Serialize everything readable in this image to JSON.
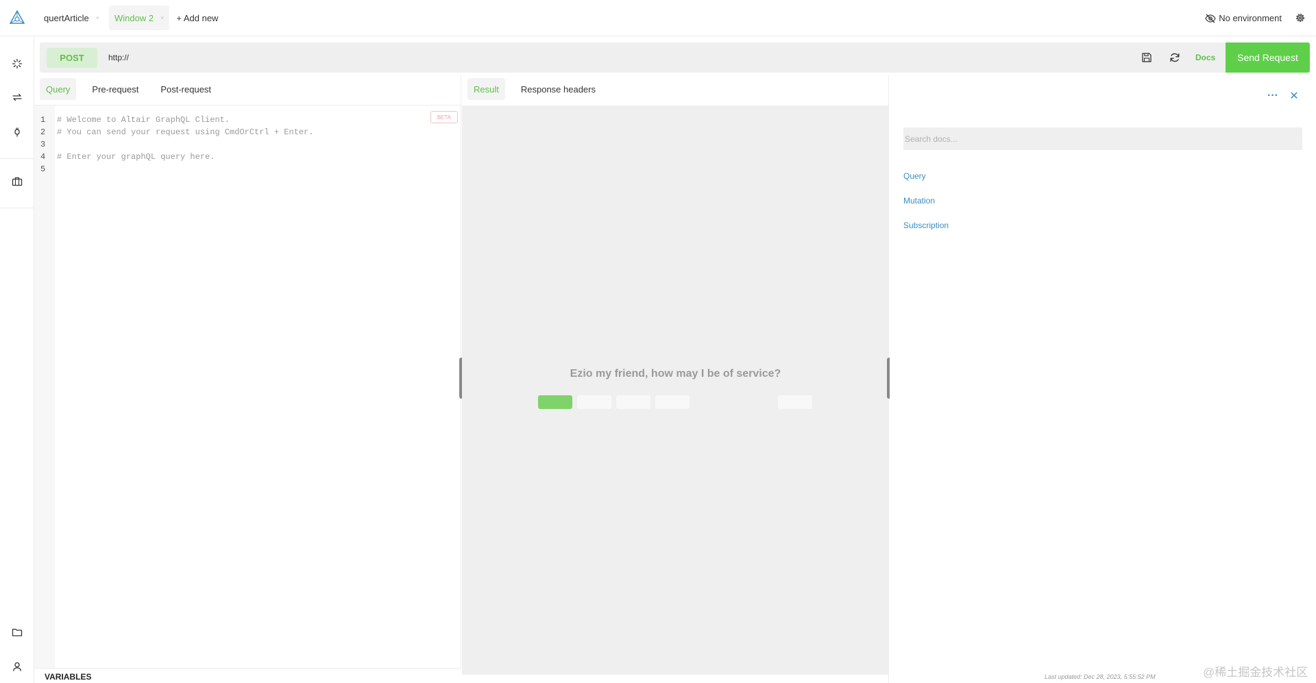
{
  "tabs": [
    {
      "label": "quertArticle",
      "close": "×"
    },
    {
      "label": "Window 2",
      "close": "×"
    }
  ],
  "add_new": "+ Add new",
  "environment": "No environment",
  "request": {
    "method": "POST",
    "url": "http://",
    "docs_label": "Docs",
    "send_label": "Send Request"
  },
  "query_tabs": [
    "Query",
    "Pre-request",
    "Post-request"
  ],
  "editor": {
    "line_numbers": [
      "1",
      "2",
      "3",
      "4",
      "5"
    ],
    "lines": [
      "# Welcome to Altair GraphQL Client.",
      "# You can send your request using CmdOrCtrl + Enter.",
      "",
      "# Enter your graphQL query here.",
      ""
    ],
    "beta_label": "BETA"
  },
  "variables_label": "VARIABLES",
  "result_tabs": [
    "Result",
    "Response headers"
  ],
  "result": {
    "empty_message": "Ezio my friend, how may I be of service?"
  },
  "docs": {
    "more_label": "···",
    "close_label": "✕",
    "search_placeholder": "Search docs...",
    "items": [
      "Query",
      "Mutation",
      "Subscription"
    ],
    "last_updated": "Last updated: Dec 28, 2023, 5:55:52 PM"
  },
  "watermark": "@稀土掘金技术社区",
  "colors": {
    "accent": "#5fcf4a",
    "link": "#3a8dc4",
    "panel": "#efefef"
  }
}
